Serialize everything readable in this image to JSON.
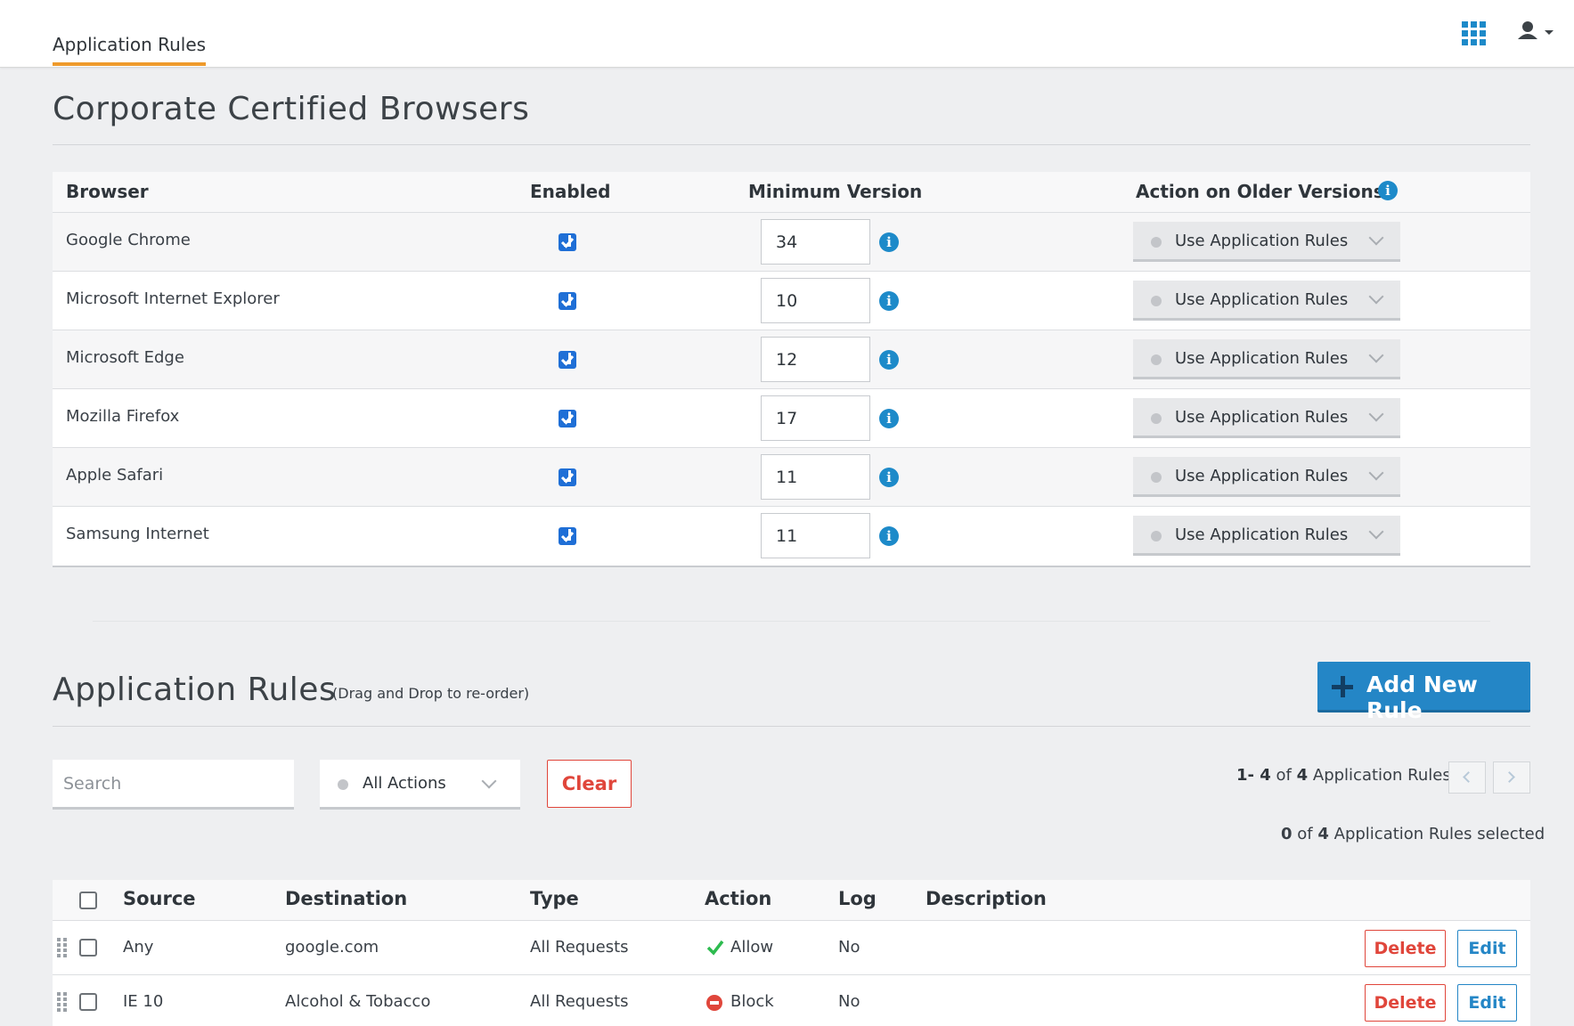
{
  "topbar": {
    "tab_label": "Application Rules"
  },
  "browsers_section": {
    "title": "Corporate Certified Browsers",
    "columns": {
      "browser": "Browser",
      "enabled": "Enabled",
      "min_version": "Minimum Version",
      "action": "Action on Older Versions"
    },
    "rows": [
      {
        "name": "Google Chrome",
        "enabled": true,
        "min_version": "34",
        "action": "Use Application Rules"
      },
      {
        "name": "Microsoft Internet Explorer",
        "enabled": true,
        "min_version": "10",
        "action": "Use Application Rules"
      },
      {
        "name": "Microsoft Edge",
        "enabled": true,
        "min_version": "12",
        "action": "Use Application Rules"
      },
      {
        "name": "Mozilla Firefox",
        "enabled": true,
        "min_version": "17",
        "action": "Use Application Rules"
      },
      {
        "name": "Apple Safari",
        "enabled": true,
        "min_version": "11",
        "action": "Use Application Rules"
      },
      {
        "name": "Samsung Internet",
        "enabled": true,
        "min_version": "11",
        "action": "Use Application Rules"
      }
    ]
  },
  "rules_section": {
    "title": "Application Rules",
    "subtitle": "(Drag and Drop to re-order)",
    "add_button": "Add New Rule",
    "search_placeholder": "Search",
    "action_filter": "All Actions",
    "clear_button": "Clear",
    "paging": {
      "range": "1- 4",
      "of": "of",
      "total": "4",
      "label": "Application Rules"
    },
    "selection": {
      "selected": "0",
      "of": "of",
      "total": "4",
      "label": "Application Rules selected"
    },
    "columns": {
      "source": "Source",
      "destination": "Destination",
      "type": "Type",
      "action": "Action",
      "log": "Log",
      "description": "Description"
    },
    "rows": [
      {
        "source": "Any",
        "destination": "google.com",
        "type": "All Requests",
        "action": "Allow",
        "log": "No",
        "description": "",
        "delete": "Delete",
        "edit": "Edit"
      },
      {
        "source": "IE 10",
        "destination": "Alcohol & Tobacco",
        "type": "All Requests",
        "action": "Block",
        "log": "No",
        "description": "",
        "delete": "Delete",
        "edit": "Edit"
      }
    ]
  },
  "colors": {
    "accent": "#ee9a2c",
    "primary": "#2486c6",
    "danger": "#e0463b",
    "allow": "#2dbb4f"
  }
}
